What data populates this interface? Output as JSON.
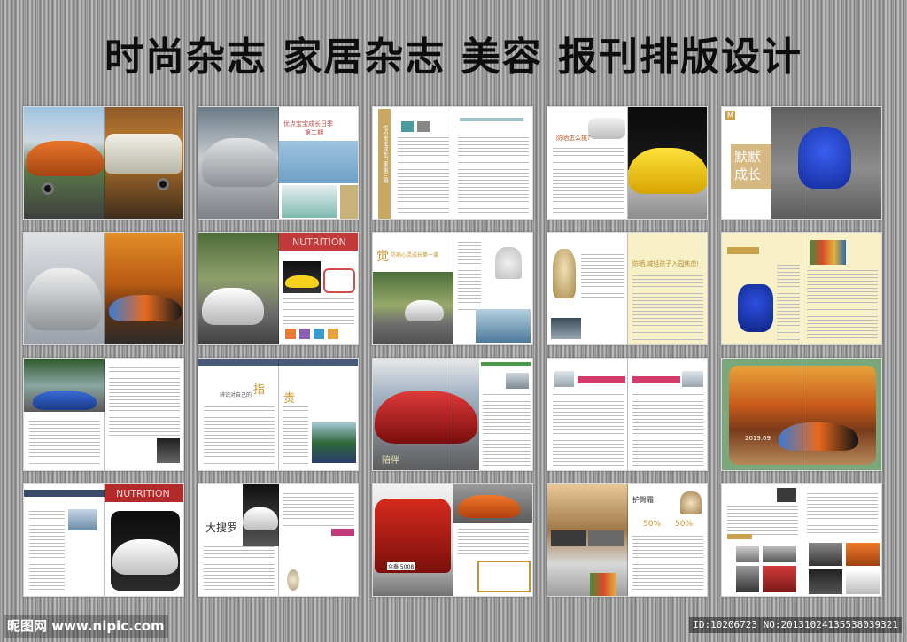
{
  "header": {
    "title": "时尚杂志 家居杂志 美容 报刊排版设计"
  },
  "spreads": {
    "r1c2": {
      "heading": "优点宝宝成长日季",
      "sub": "第二期"
    },
    "r1c3": {
      "vertical_heading": "优点宝宝成长日季第三期"
    },
    "r1c4": {
      "heading": "防晒怎么挑?"
    },
    "r1c5": {
      "heading": "默默 成长",
      "badge": "M"
    },
    "r2c2": {
      "heading": "NUTRITION"
    },
    "r2c3": {
      "heading": "觉",
      "sub": "防病心灵成长第一课"
    },
    "r2c4": {
      "heading": "防晒,减轻孩子入园焦虑!"
    },
    "r3c2": {
      "heading": "指",
      "heading2": "责",
      "sub": "辨识对自己的"
    },
    "r3c3": {
      "heading": "陪伴"
    },
    "r3c5": {
      "date": "2019.09"
    },
    "r4c1": {
      "heading": "NUTRITION"
    },
    "r4c2": {
      "heading": "大搜罗"
    },
    "r4c3": {
      "plate": "众泰 5008"
    },
    "r4c4": {
      "heading": "护臀霜",
      "pct1": "50%",
      "pct2": "50%"
    }
  },
  "footer": {
    "logo": "昵图网 www.nipic.com",
    "id": "ID:10206723 NO:20131024135538039321"
  }
}
